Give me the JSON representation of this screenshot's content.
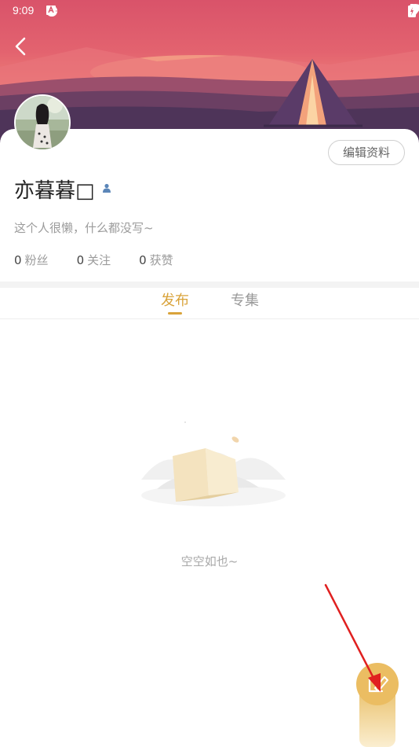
{
  "status_bar": {
    "time": "9:09",
    "notification_icons": [
      "app-notification-icon",
      "app-notification-icon",
      "android-debug-icon"
    ],
    "wifi_icon": "wifi-icon",
    "battery_icon": "battery-icon"
  },
  "header": {
    "back_icon": "chevron-left-icon"
  },
  "profile": {
    "edit_label": "编辑资料",
    "username": "亦暮暮□",
    "bio": "这个人很懒，什么都没写~",
    "stats": [
      {
        "count": "0",
        "label": "粉丝"
      },
      {
        "count": "0",
        "label": "关注"
      },
      {
        "count": "0",
        "label": "获赞"
      }
    ]
  },
  "tabs": [
    {
      "label": "发布",
      "active": true
    },
    {
      "label": "专集",
      "active": false
    }
  ],
  "empty_state": {
    "text": "空空如也~"
  },
  "fab": {
    "icon": "compose-icon"
  },
  "colors": {
    "accent": "#d9a33a",
    "fab": "#ebbd62",
    "annotation_arrow": "#e02020"
  }
}
